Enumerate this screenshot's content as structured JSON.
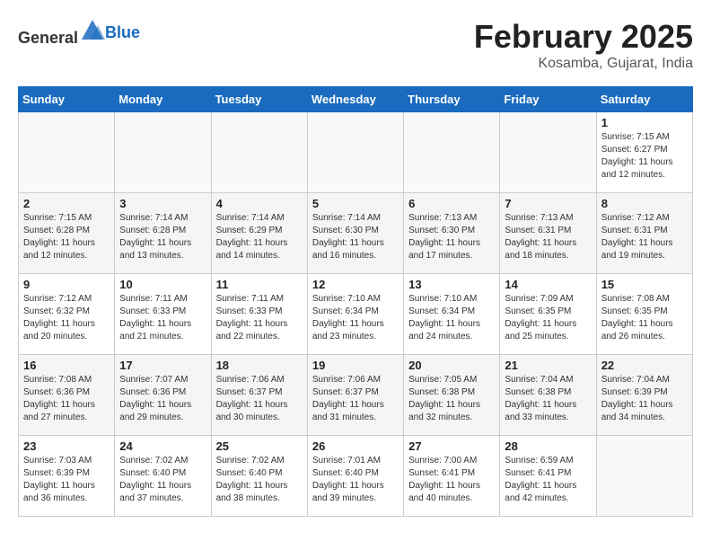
{
  "header": {
    "logo_general": "General",
    "logo_blue": "Blue",
    "title": "February 2025",
    "location": "Kosamba, Gujarat, India"
  },
  "days_of_week": [
    "Sunday",
    "Monday",
    "Tuesday",
    "Wednesday",
    "Thursday",
    "Friday",
    "Saturday"
  ],
  "weeks": [
    [
      {
        "day": "",
        "empty": true
      },
      {
        "day": "",
        "empty": true
      },
      {
        "day": "",
        "empty": true
      },
      {
        "day": "",
        "empty": true
      },
      {
        "day": "",
        "empty": true
      },
      {
        "day": "",
        "empty": true
      },
      {
        "day": "1",
        "sunrise": "7:15 AM",
        "sunset": "6:27 PM",
        "daylight": "11 hours and 12 minutes."
      }
    ],
    [
      {
        "day": "2",
        "sunrise": "7:15 AM",
        "sunset": "6:28 PM",
        "daylight": "11 hours and 12 minutes."
      },
      {
        "day": "3",
        "sunrise": "7:14 AM",
        "sunset": "6:28 PM",
        "daylight": "11 hours and 13 minutes."
      },
      {
        "day": "4",
        "sunrise": "7:14 AM",
        "sunset": "6:29 PM",
        "daylight": "11 hours and 14 minutes."
      },
      {
        "day": "5",
        "sunrise": "7:14 AM",
        "sunset": "6:30 PM",
        "daylight": "11 hours and 16 minutes."
      },
      {
        "day": "6",
        "sunrise": "7:13 AM",
        "sunset": "6:30 PM",
        "daylight": "11 hours and 17 minutes."
      },
      {
        "day": "7",
        "sunrise": "7:13 AM",
        "sunset": "6:31 PM",
        "daylight": "11 hours and 18 minutes."
      },
      {
        "day": "8",
        "sunrise": "7:12 AM",
        "sunset": "6:31 PM",
        "daylight": "11 hours and 19 minutes."
      }
    ],
    [
      {
        "day": "9",
        "sunrise": "7:12 AM",
        "sunset": "6:32 PM",
        "daylight": "11 hours and 20 minutes."
      },
      {
        "day": "10",
        "sunrise": "7:11 AM",
        "sunset": "6:33 PM",
        "daylight": "11 hours and 21 minutes."
      },
      {
        "day": "11",
        "sunrise": "7:11 AM",
        "sunset": "6:33 PM",
        "daylight": "11 hours and 22 minutes."
      },
      {
        "day": "12",
        "sunrise": "7:10 AM",
        "sunset": "6:34 PM",
        "daylight": "11 hours and 23 minutes."
      },
      {
        "day": "13",
        "sunrise": "7:10 AM",
        "sunset": "6:34 PM",
        "daylight": "11 hours and 24 minutes."
      },
      {
        "day": "14",
        "sunrise": "7:09 AM",
        "sunset": "6:35 PM",
        "daylight": "11 hours and 25 minutes."
      },
      {
        "day": "15",
        "sunrise": "7:08 AM",
        "sunset": "6:35 PM",
        "daylight": "11 hours and 26 minutes."
      }
    ],
    [
      {
        "day": "16",
        "sunrise": "7:08 AM",
        "sunset": "6:36 PM",
        "daylight": "11 hours and 27 minutes."
      },
      {
        "day": "17",
        "sunrise": "7:07 AM",
        "sunset": "6:36 PM",
        "daylight": "11 hours and 29 minutes."
      },
      {
        "day": "18",
        "sunrise": "7:06 AM",
        "sunset": "6:37 PM",
        "daylight": "11 hours and 30 minutes."
      },
      {
        "day": "19",
        "sunrise": "7:06 AM",
        "sunset": "6:37 PM",
        "daylight": "11 hours and 31 minutes."
      },
      {
        "day": "20",
        "sunrise": "7:05 AM",
        "sunset": "6:38 PM",
        "daylight": "11 hours and 32 minutes."
      },
      {
        "day": "21",
        "sunrise": "7:04 AM",
        "sunset": "6:38 PM",
        "daylight": "11 hours and 33 minutes."
      },
      {
        "day": "22",
        "sunrise": "7:04 AM",
        "sunset": "6:39 PM",
        "daylight": "11 hours and 34 minutes."
      }
    ],
    [
      {
        "day": "23",
        "sunrise": "7:03 AM",
        "sunset": "6:39 PM",
        "daylight": "11 hours and 36 minutes."
      },
      {
        "day": "24",
        "sunrise": "7:02 AM",
        "sunset": "6:40 PM",
        "daylight": "11 hours and 37 minutes."
      },
      {
        "day": "25",
        "sunrise": "7:02 AM",
        "sunset": "6:40 PM",
        "daylight": "11 hours and 38 minutes."
      },
      {
        "day": "26",
        "sunrise": "7:01 AM",
        "sunset": "6:40 PM",
        "daylight": "11 hours and 39 minutes."
      },
      {
        "day": "27",
        "sunrise": "7:00 AM",
        "sunset": "6:41 PM",
        "daylight": "11 hours and 40 minutes."
      },
      {
        "day": "28",
        "sunrise": "6:59 AM",
        "sunset": "6:41 PM",
        "daylight": "11 hours and 42 minutes."
      },
      {
        "day": "",
        "empty": true
      }
    ]
  ],
  "labels": {
    "sunrise": "Sunrise:",
    "sunset": "Sunset:",
    "daylight": "Daylight:"
  }
}
